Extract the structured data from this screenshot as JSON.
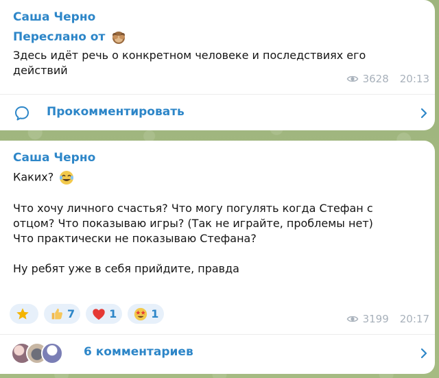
{
  "posts": [
    {
      "sender": "Саша Черно",
      "forwarded_label": "Переслано от",
      "forwarded_icon": "monkey-see-no-evil-emoji",
      "text_line1": "Здесь идёт речь о конкретном человеке и последствиях его",
      "text_line2": "действий",
      "views": "3628",
      "time": "20:13",
      "comment_label": "Прокомментировать"
    },
    {
      "sender": "Саша Черно",
      "text_line1": "Каких?",
      "text_emoji": "laughing-crying-emoji",
      "text_line2": "Что хочу личного счастья? Что могу погулять когда Стефан с",
      "text_line3": "отцом? Что показываю игры? (Так не играйте, проблемы нет)",
      "text_line4": "Что практически не показываю Стефана?",
      "text_line5": "Ну ребят уже в себя прийдите, правда",
      "reactions": [
        {
          "icon": "star-emoji",
          "count": ""
        },
        {
          "icon": "thumbs-up-emoji",
          "count": "7"
        },
        {
          "icon": "red-heart-emoji",
          "count": "1"
        },
        {
          "icon": "star-struck-emoji",
          "count": "1"
        }
      ],
      "views": "3199",
      "time": "20:17",
      "comment_label": "6 комментариев"
    }
  ],
  "colors": {
    "accent": "#2d86c8",
    "meta": "#a8b1bb",
    "background": "#9eb47d",
    "reaction_bg": "#e7f0fa"
  }
}
